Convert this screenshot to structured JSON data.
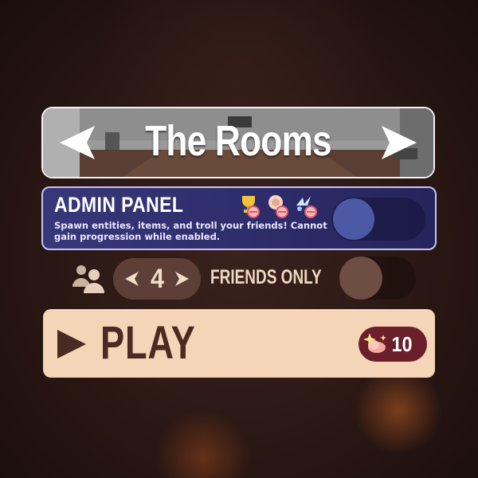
{
  "map_selector": {
    "title": "The Rooms",
    "prev_icon": "arrow-left-icon",
    "next_icon": "arrow-right-icon"
  },
  "admin_panel": {
    "title": "ADMIN PANEL",
    "description": "Spawn entities, items, and troll your friends! Cannot gain progression while enabled.",
    "disabled_icons": [
      "no-trophy-icon",
      "no-unlock-icon",
      "no-xp-icon"
    ],
    "toggle_enabled": false
  },
  "lobby": {
    "players_icon": "players-icon",
    "player_count": "4",
    "friends_only_label": "FRIENDS ONLY",
    "friends_only_enabled": false
  },
  "play": {
    "label": "PLAY",
    "cost": "10",
    "cost_icon": "sparkle-currency-icon"
  },
  "colors": {
    "admin_bg": "#2d2c69",
    "admin_border": "#c9c3f3",
    "play_bg": "#f5d5b8",
    "play_text": "#4a2a21",
    "cost_badge": "#6a1f2a",
    "stepper_bg": "#5e3f37"
  }
}
